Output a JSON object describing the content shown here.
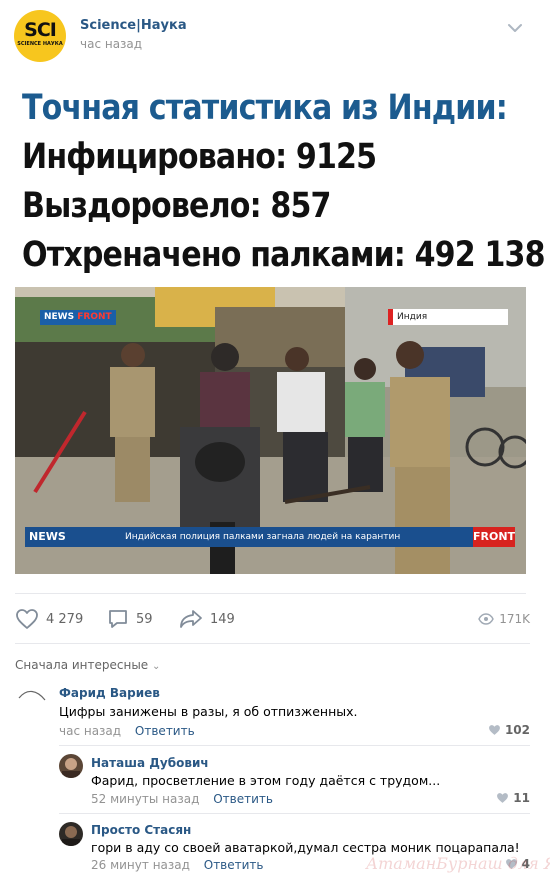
{
  "post": {
    "group_name": "Science|Наука",
    "time": "час назад",
    "avatar_logo": "SCI",
    "avatar_sub": "SCIENCE НАУКА"
  },
  "headline": {
    "line1": "Точная статистика из Индии:",
    "line2": "Инфицировано: 9125",
    "line3": "Выздоровело: 857",
    "line4": "Отхреначено палками: 492 138"
  },
  "photo": {
    "badge_news": "NEWS",
    "badge_front": "FRONT",
    "location": "Индия",
    "lower_news": "NEWS",
    "caption": "Индийская полиция палками загнала людей на карантин",
    "lower_front": "FRONT"
  },
  "actions": {
    "likes": "4 279",
    "comments": "59",
    "shares": "149",
    "views": "171K"
  },
  "comments_sort": "Сначала интересные",
  "comments": [
    {
      "author": "Фарид Вариев",
      "text": "Цифры занижены в разы, я об отпизженных.",
      "time": "час назад",
      "reply": "Ответить",
      "likes": "102"
    },
    {
      "author": "Наташа Дубович",
      "text": "Фарид, просветление в этом году даётся с трудом...",
      "time": "52 минуты назад",
      "reply": "Ответить",
      "likes": "11"
    },
    {
      "author": "Просто Стасян",
      "text": "гори в аду со своей аватаркой,думал сестра моник поцарапала!",
      "time": "26 минут назад",
      "reply": "Ответить",
      "likes": "4"
    }
  ],
  "watermark": "АтаманБурнаш для ЯП",
  "colors": {
    "link": "#2a5885",
    "headline_blue": "#1c5b8f",
    "meta_gray": "#939393",
    "avatar_yellow": "#f7c61e"
  },
  "icons": [
    "heart-icon",
    "comment-icon",
    "share-icon",
    "eye-icon",
    "chevron-down-icon"
  ]
}
